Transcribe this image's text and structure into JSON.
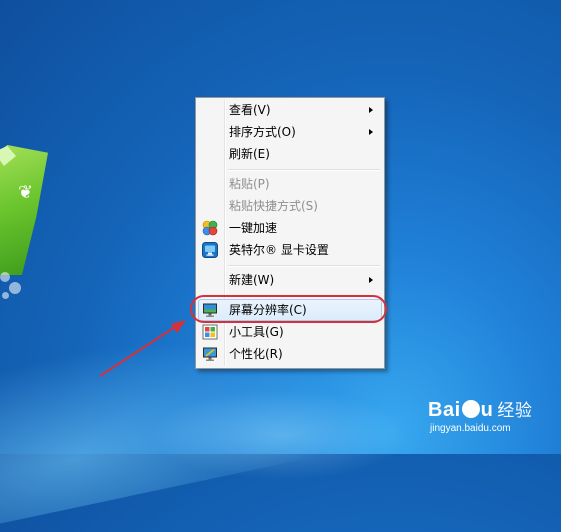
{
  "menu": {
    "items": [
      {
        "label": "查看(V)",
        "submenu": true,
        "disabled": false
      },
      {
        "label": "排序方式(O)",
        "submenu": true,
        "disabled": false
      },
      {
        "label": "刷新(E)",
        "submenu": false,
        "disabled": false
      },
      {
        "label": "粘贴(P)",
        "submenu": false,
        "disabled": true
      },
      {
        "label": "粘贴快捷方式(S)",
        "submenu": false,
        "disabled": true
      },
      {
        "label": "一键加速",
        "submenu": false,
        "disabled": false,
        "icon": "speedup-icon"
      },
      {
        "label": "英特尔® 显卡设置",
        "submenu": false,
        "disabled": false,
        "icon": "intel-graphics-icon"
      },
      {
        "label": "新建(W)",
        "submenu": true,
        "disabled": false
      },
      {
        "label": "屏幕分辨率(C)",
        "submenu": false,
        "disabled": false,
        "icon": "screen-resolution-icon",
        "highlighted": true
      },
      {
        "label": "小工具(G)",
        "submenu": false,
        "disabled": false,
        "icon": "gadgets-icon"
      },
      {
        "label": "个性化(R)",
        "submenu": false,
        "disabled": false,
        "icon": "personalize-icon"
      }
    ]
  },
  "watermark": {
    "logo_left": "Bai",
    "logo_right": "u",
    "jingyan": "经验",
    "url": "jingyan.baidu.com"
  },
  "colors": {
    "annotation": "#d8303a",
    "desktop": "#1f7fd6",
    "menu_bg": "#f5f5f5"
  }
}
